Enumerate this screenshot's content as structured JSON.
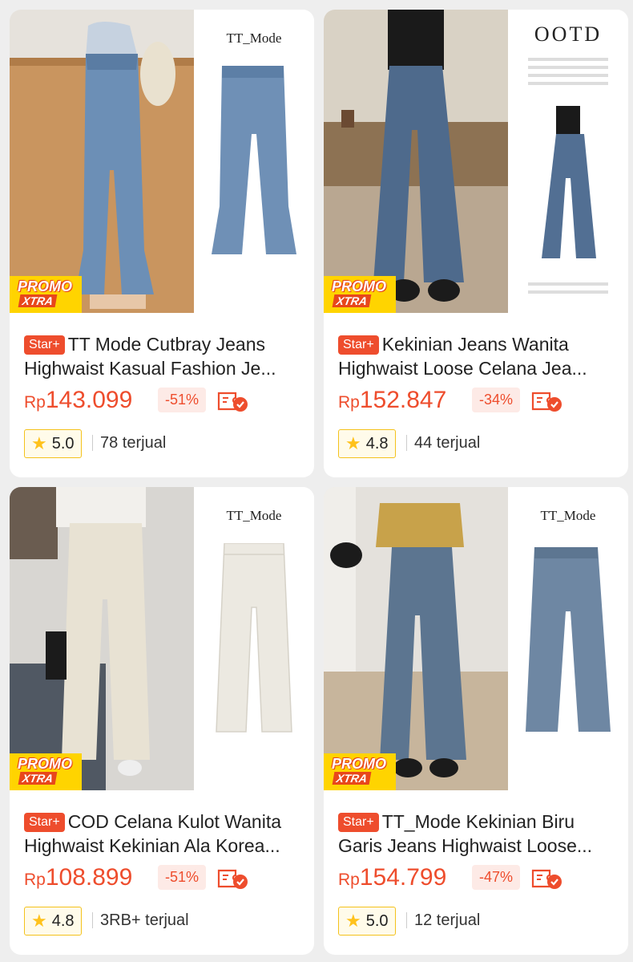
{
  "products": [
    {
      "brand": "TT_Mode",
      "badge": "Star+",
      "title_line1": "TT Mode Cutbray Jeans",
      "title_line2": "Highwaist Kasual Fashion Je...",
      "currency": "Rp",
      "price": "143.099",
      "discount": "-51%",
      "rating": "5.0",
      "sold": "78 terjual",
      "promo_line1": "PROMO",
      "promo_line2": "XTRA"
    },
    {
      "brand": "OOTD",
      "badge": "Star+",
      "title_line1": "Kekinian Jeans Wanita",
      "title_line2": "Highwaist Loose Celana Jea...",
      "currency": "Rp",
      "price": "152.847",
      "discount": "-34%",
      "rating": "4.8",
      "sold": "44 terjual",
      "promo_line1": "PROMO",
      "promo_line2": "XTRA"
    },
    {
      "brand": "TT_Mode",
      "badge": "Star+",
      "title_line1": "COD Celana Kulot Wanita",
      "title_line2": "Highwaist Kekinian Ala Korea...",
      "currency": "Rp",
      "price": "108.899",
      "discount": "-51%",
      "rating": "4.8",
      "sold": "3RB+ terjual",
      "promo_line1": "PROMO",
      "promo_line2": "XTRA"
    },
    {
      "brand": "TT_Mode",
      "badge": "Star+",
      "title_line1": "TT_Mode Kekinian Biru",
      "title_line2": "Garis Jeans Highwaist Loose...",
      "currency": "Rp",
      "price": "154.799",
      "discount": "-47%",
      "rating": "5.0",
      "sold": "12 terjual",
      "promo_line1": "PROMO",
      "promo_line2": "XTRA"
    }
  ],
  "colors": {
    "accent": "#ee4d2d",
    "promo_yellow": "#ffd400",
    "star": "#ffc21c"
  }
}
